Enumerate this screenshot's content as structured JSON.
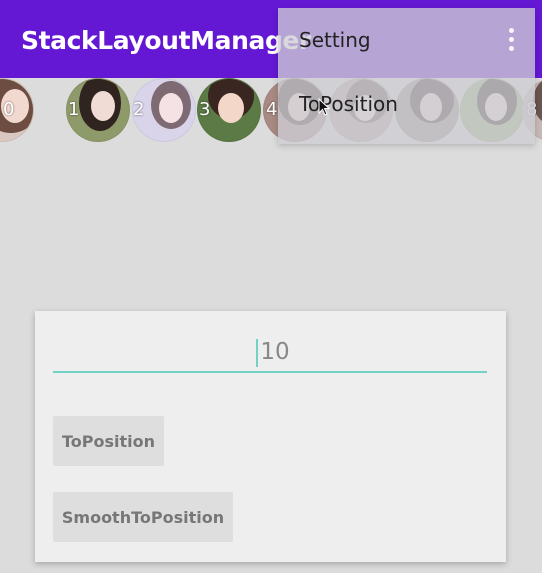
{
  "appbar": {
    "title": "StackLayoutManager",
    "background": "#6418d4"
  },
  "strip": {
    "items": [
      {
        "number": "0"
      },
      {
        "number": "1"
      },
      {
        "number": "2"
      },
      {
        "number": "3"
      },
      {
        "number": "4"
      },
      {
        "number": ""
      },
      {
        "number": ""
      },
      {
        "number": ""
      },
      {
        "number": "8"
      }
    ]
  },
  "menu": {
    "items": [
      {
        "label": "Setting"
      },
      {
        "label": "ToPosition"
      }
    ],
    "overflow_icon": "more-vert-icon"
  },
  "card": {
    "input": {
      "value": "10"
    },
    "accent": "#72d3c4",
    "buttons": {
      "to_position": "ToPosition",
      "smooth_to_position": "SmoothToPosition"
    }
  }
}
